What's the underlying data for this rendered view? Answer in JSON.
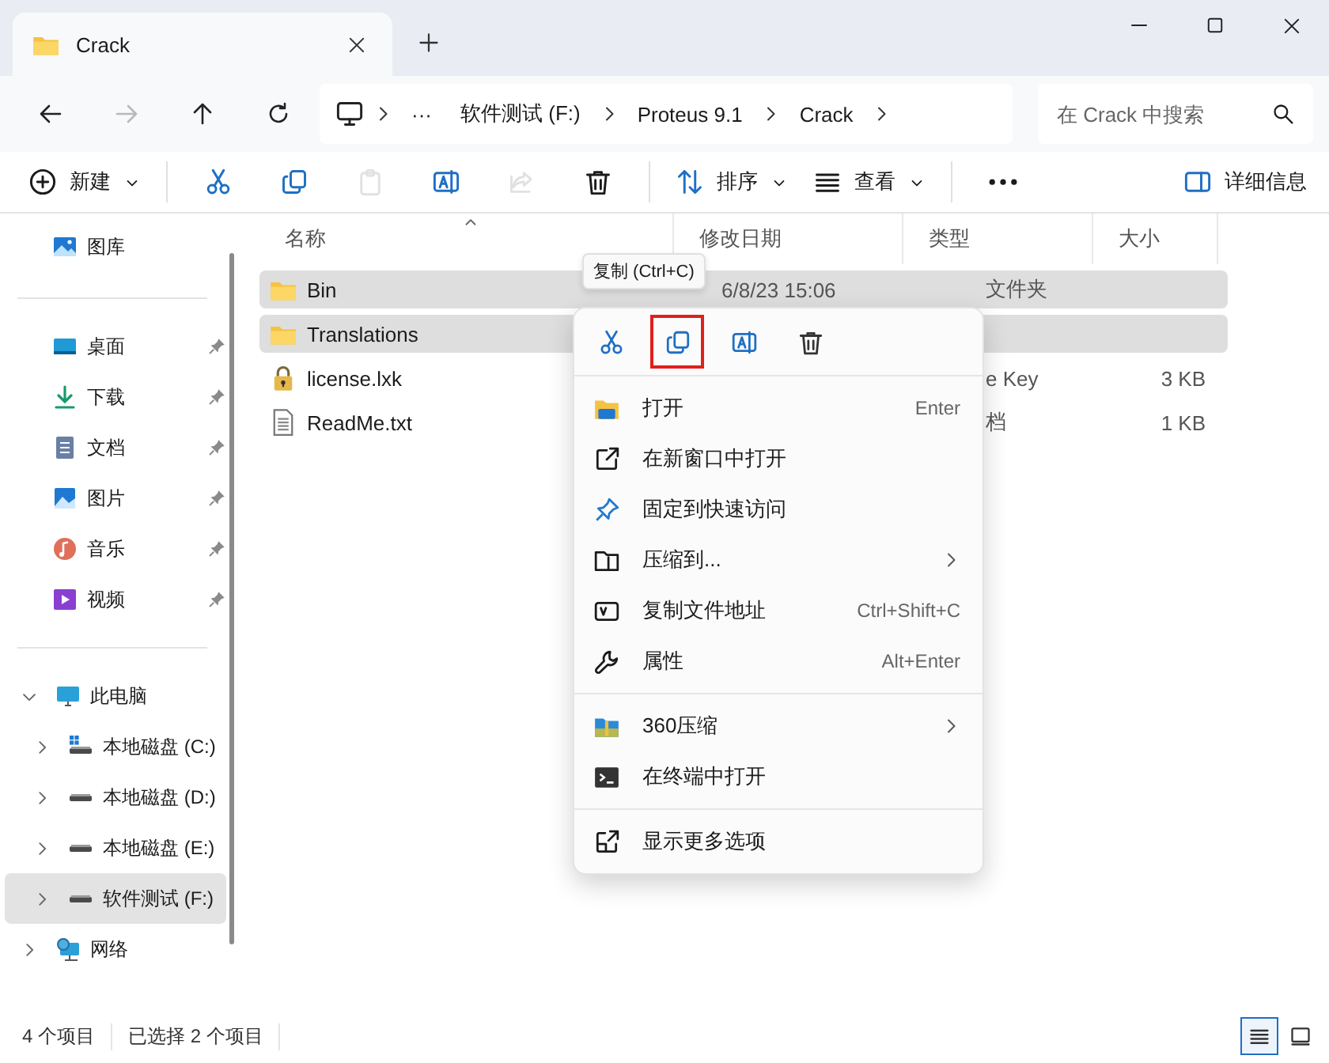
{
  "window": {
    "tab_title": "Crack"
  },
  "nav": {
    "buttons": [
      {
        "kind": "back",
        "disabled": false
      },
      {
        "kind": "forward",
        "disabled": true
      },
      {
        "kind": "up",
        "disabled": false
      },
      {
        "kind": "refresh",
        "disabled": false
      }
    ],
    "overflow": "···",
    "crumbs": [
      "软件测试 (F:)",
      "Proteus 9.1",
      "Crack"
    ],
    "search": {
      "placeholder": "在 Crack 中搜索"
    }
  },
  "toolbar": {
    "items": [
      {
        "kind": "new",
        "label": "新建",
        "disabled": false
      },
      {
        "kind": "separator"
      },
      {
        "kind": "cut",
        "disabled": false
      },
      {
        "kind": "copy",
        "disabled": false
      },
      {
        "kind": "paste",
        "disabled": true
      },
      {
        "kind": "rename",
        "disabled": false
      },
      {
        "kind": "share",
        "disabled": true
      },
      {
        "kind": "delete",
        "disabled": false
      },
      {
        "kind": "separator"
      },
      {
        "kind": "sort",
        "label": "排序",
        "disabled": false
      },
      {
        "kind": "view",
        "label": "查看",
        "disabled": false
      },
      {
        "kind": "separator"
      },
      {
        "kind": "more",
        "disabled": false
      },
      {
        "kind": "details",
        "label": "详细信息",
        "disabled": false
      }
    ]
  },
  "sidebar": {
    "quick": [
      {
        "kind": "gallery",
        "label": "图库",
        "pinned": false
      },
      {
        "kind": "separator"
      },
      {
        "kind": "desktop",
        "label": "桌面",
        "pinned": true
      },
      {
        "kind": "download",
        "label": "下载",
        "pinned": true
      },
      {
        "kind": "document",
        "label": "文档",
        "pinned": true
      },
      {
        "kind": "pictures",
        "label": "图片",
        "pinned": true
      },
      {
        "kind": "music",
        "label": "音乐",
        "pinned": true
      },
      {
        "kind": "video",
        "label": "视频",
        "pinned": true
      }
    ],
    "tree": [
      {
        "kind": "pc",
        "label": "此电脑",
        "expanded": true,
        "selected": false,
        "children": [
          {
            "kind": "windrive",
            "label": "本地磁盘 (C:)",
            "expanded": false,
            "selected": false
          },
          {
            "kind": "drive",
            "label": "本地磁盘 (D:)",
            "expanded": false,
            "selected": false
          },
          {
            "kind": "drive",
            "label": "本地磁盘 (E:)",
            "expanded": false,
            "selected": false
          },
          {
            "kind": "drive",
            "label": "软件测试 (F:)",
            "expanded": false,
            "selected": true
          }
        ]
      },
      {
        "kind": "network",
        "label": "网络",
        "expanded": false,
        "selected": false
      }
    ]
  },
  "file_list": {
    "columns": [
      "名称",
      "修改日期",
      "类型",
      "大小"
    ],
    "rows": [
      {
        "kind": "folder",
        "name": "Bin",
        "selected": true,
        "date": "6/8/23 15:06",
        "type": "文件夹"
      },
      {
        "kind": "folder",
        "name": "Translations",
        "selected": true
      },
      {
        "kind": "lock",
        "name": "license.lxk",
        "selected": false,
        "type": "e Key",
        "size": "3 KB"
      },
      {
        "kind": "text",
        "name": "ReadMe.txt",
        "selected": false,
        "type": "档",
        "size": "1 KB"
      }
    ]
  },
  "context_menu": {
    "tooltip": "复制 (Ctrl+C)",
    "actions": [
      {
        "kind": "cut",
        "highlighted": false
      },
      {
        "kind": "copy",
        "highlighted": true
      },
      {
        "kind": "rename",
        "highlighted": false
      },
      {
        "kind": "delete",
        "highlighted": false
      }
    ],
    "items": [
      {
        "kind": "open",
        "label": "打开",
        "shortcut": "Enter",
        "submenu": false
      },
      {
        "kind": "newwindow",
        "label": "在新窗口中打开",
        "submenu": false
      },
      {
        "kind": "pin",
        "label": "固定到快速访问",
        "submenu": false
      },
      {
        "kind": "zip",
        "label": "压缩到...",
        "submenu": true
      },
      {
        "kind": "copypath",
        "label": "复制文件地址",
        "shortcut": "Ctrl+Shift+C",
        "submenu": false
      },
      {
        "kind": "wrench",
        "label": "属性",
        "shortcut": "Alt+Enter",
        "submenu": false
      },
      {
        "kind": "separator"
      },
      {
        "kind": "archive",
        "label": "360压缩",
        "submenu": true
      },
      {
        "kind": "terminal",
        "label": "在终端中打开",
        "submenu": false
      },
      {
        "kind": "separator"
      },
      {
        "kind": "moreoptions",
        "label": "显示更多选项",
        "submenu": false
      }
    ]
  },
  "status_bar": {
    "count": "4 个项目",
    "selection": "已选择 2 个项目",
    "views": [
      {
        "kind": "details",
        "selected": true
      },
      {
        "kind": "tiles",
        "selected": false
      }
    ]
  }
}
